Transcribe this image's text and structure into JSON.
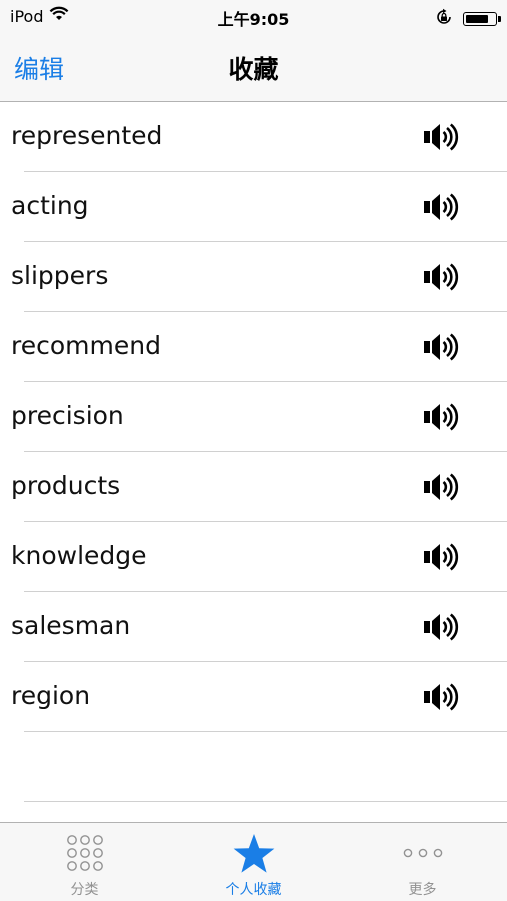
{
  "status_bar": {
    "device": "iPod",
    "time": "上午9:05"
  },
  "nav": {
    "edit_label": "编辑",
    "title": "收藏"
  },
  "words": [
    "represented",
    "acting",
    "slippers",
    "recommend",
    "precision",
    "products",
    "knowledge",
    "salesman",
    "region"
  ],
  "tabs": [
    {
      "label": "分类",
      "icon": "grid-dots-icon",
      "active": false
    },
    {
      "label": "个人收藏",
      "icon": "star-icon",
      "active": true
    },
    {
      "label": "更多",
      "icon": "more-dots-icon",
      "active": false
    }
  ],
  "colors": {
    "accent": "#1a7ee6",
    "inactive": "#929292",
    "bar_background": "#f7f7f7",
    "separator": "#d0d0d0"
  }
}
